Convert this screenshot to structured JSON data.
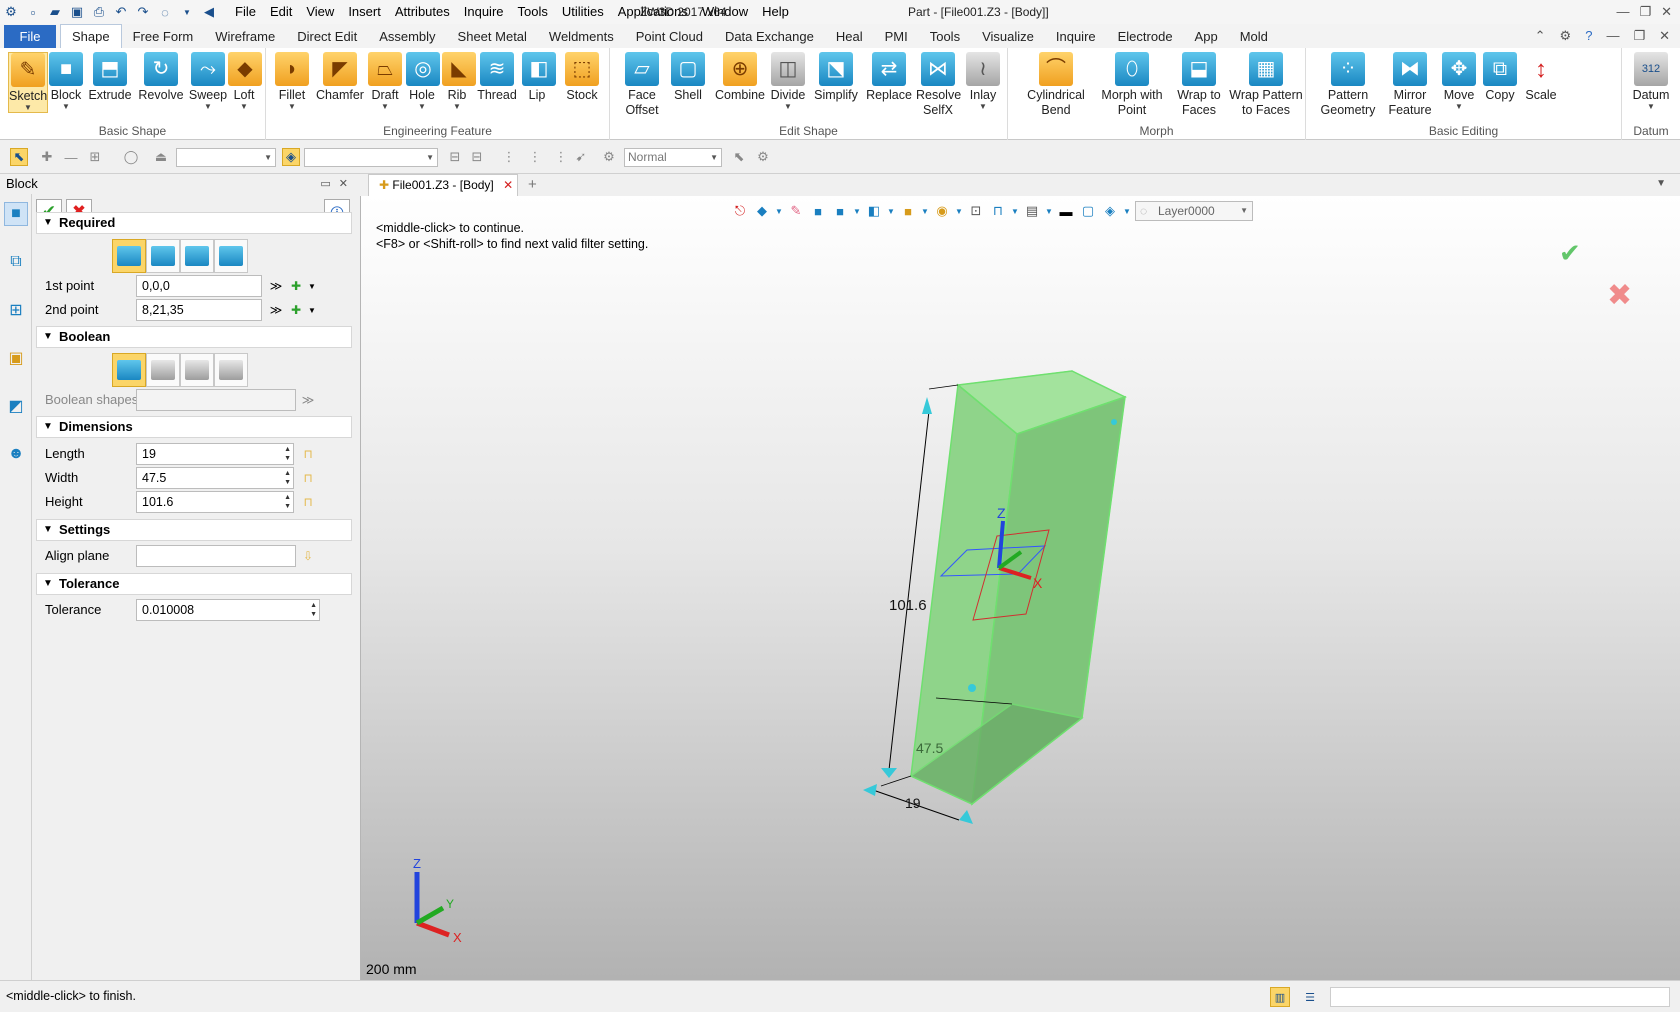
{
  "titlebar": {
    "menus": [
      "File",
      "Edit",
      "View",
      "Insert",
      "Attributes",
      "Inquire",
      "Tools",
      "Utilities",
      "Applications",
      "Window",
      "Help"
    ],
    "app": "ZW3D 2017  x64",
    "document": "Part - [File001.Z3 - [Body]]"
  },
  "ribbon_tabs": [
    "File",
    "Shape",
    "Free Form",
    "Wireframe",
    "Direct Edit",
    "Assembly",
    "Sheet Metal",
    "Weldments",
    "Point Cloud",
    "Data Exchange",
    "Heal",
    "PMI",
    "Tools",
    "Visualize",
    "Inquire",
    "Electrode",
    "App",
    "Mold"
  ],
  "active_ribbon_tab": "Shape",
  "ribbon": {
    "basic_shape": {
      "label": "Basic Shape",
      "buttons": [
        "Sketch",
        "Block",
        "Extrude",
        "Revolve",
        "Sweep",
        "Loft"
      ]
    },
    "engineering_feature": {
      "label": "Engineering Feature",
      "buttons": [
        "Fillet",
        "Chamfer",
        "Draft",
        "Hole",
        "Rib",
        "Thread",
        "Lip",
        "Stock"
      ]
    },
    "edit_shape": {
      "label": "Edit Shape",
      "buttons": [
        "Face\nOffset",
        "Shell",
        "Combine",
        "Divide",
        "Simplify",
        "Replace",
        "Resolve\nSelfX",
        "Inlay"
      ]
    },
    "morph": {
      "label": "Morph",
      "buttons": [
        "Cylindrical\nBend",
        "Morph with\nPoint",
        "Wrap to\nFaces",
        "Wrap Pattern\nto Faces"
      ]
    },
    "basic_editing": {
      "label": "Basic Editing",
      "buttons": [
        "Pattern\nGeometry",
        "Mirror\nFeature",
        "Move",
        "Copy",
        "Scale"
      ]
    },
    "datum": {
      "label": "Datum",
      "buttons": [
        "Datum"
      ]
    }
  },
  "toolbar2": {
    "render_mode": "Normal"
  },
  "panel": {
    "title": "Block",
    "sections": {
      "required": "Required",
      "boolean": "Boolean",
      "dimensions": "Dimensions",
      "settings": "Settings",
      "tolerance": "Tolerance"
    },
    "first_point_label": "1st point",
    "first_point_value": "0,0,0",
    "second_point_label": "2nd point",
    "second_point_value": "8,21,35",
    "boolean_shapes_label": "Boolean shapes",
    "length_label": "Length",
    "length_value": "19",
    "width_label": "Width",
    "width_value": "47.5",
    "height_label": "Height",
    "height_value": "101.6",
    "align_plane_label": "Align plane",
    "tolerance_label": "Tolerance",
    "tolerance_value": "0.010008"
  },
  "viewport": {
    "doc_tab": "File001.Z3 - [Body]",
    "layer": "Layer0000",
    "prompt_line1": "<middle-click> to continue.",
    "prompt_line2": "<F8> or <Shift-roll> to find next valid filter setting.",
    "dim_height": "101.6",
    "dim_width": "47.5",
    "dim_length": "19",
    "axis_x": "X",
    "axis_y": "Y",
    "axis_z": "Z",
    "scale": "200 mm"
  },
  "status": {
    "text": "<middle-click> to finish."
  },
  "colors": {
    "accent": "#2b6bc4",
    "solid": "#8fd98a",
    "edge": "#5fd35f",
    "handle": "#36c9d9"
  }
}
